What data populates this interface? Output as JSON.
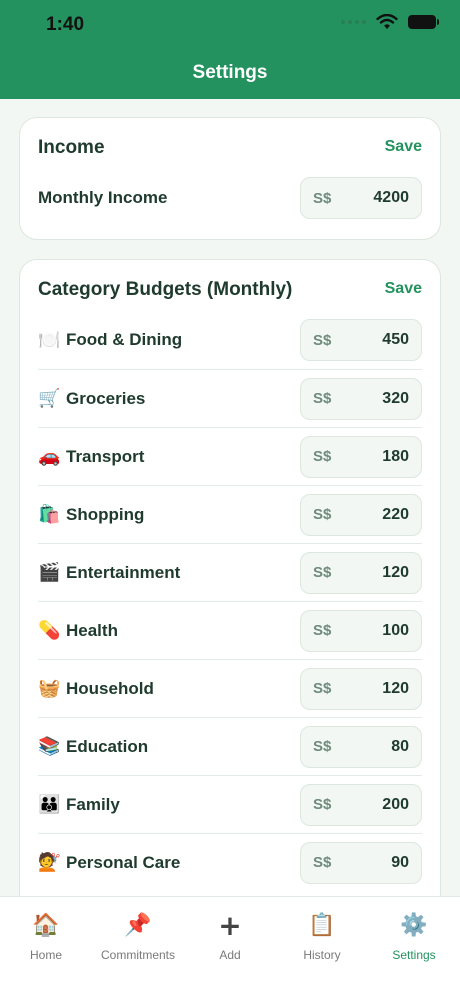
{
  "status_bar": {
    "time": "1:40"
  },
  "header": {
    "title": "Settings"
  },
  "income_card": {
    "title": "Income",
    "save_label": "Save",
    "monthly_income_label": "Monthly Income",
    "currency": "S$",
    "monthly_income_value": "4200"
  },
  "budgets_card": {
    "title": "Category Budgets (Monthly)",
    "save_label": "Save",
    "currency": "S$",
    "categories": [
      {
        "emoji": "🍽️",
        "label": "Food & Dining",
        "value": "450"
      },
      {
        "emoji": "🛒",
        "label": "Groceries",
        "value": "320"
      },
      {
        "emoji": "🚗",
        "label": "Transport",
        "value": "180"
      },
      {
        "emoji": "🛍️",
        "label": "Shopping",
        "value": "220"
      },
      {
        "emoji": "🎬",
        "label": "Entertainment",
        "value": "120"
      },
      {
        "emoji": "💊",
        "label": "Health",
        "value": "100"
      },
      {
        "emoji": "🧺",
        "label": "Household",
        "value": "120"
      },
      {
        "emoji": "📚",
        "label": "Education",
        "value": "80"
      },
      {
        "emoji": "👪",
        "label": "Family",
        "value": "200"
      },
      {
        "emoji": "💇",
        "label": "Personal Care",
        "value": "90"
      }
    ]
  },
  "tabbar": {
    "tabs": [
      {
        "icon": "🏠",
        "label": "Home"
      },
      {
        "icon": "📌",
        "label": "Commitments"
      },
      {
        "icon": "+",
        "label": "Add"
      },
      {
        "icon": "📋",
        "label": "History"
      },
      {
        "icon": "⚙️",
        "label": "Settings"
      }
    ],
    "active_tab": "Settings",
    "accent_color": "#23925e"
  }
}
